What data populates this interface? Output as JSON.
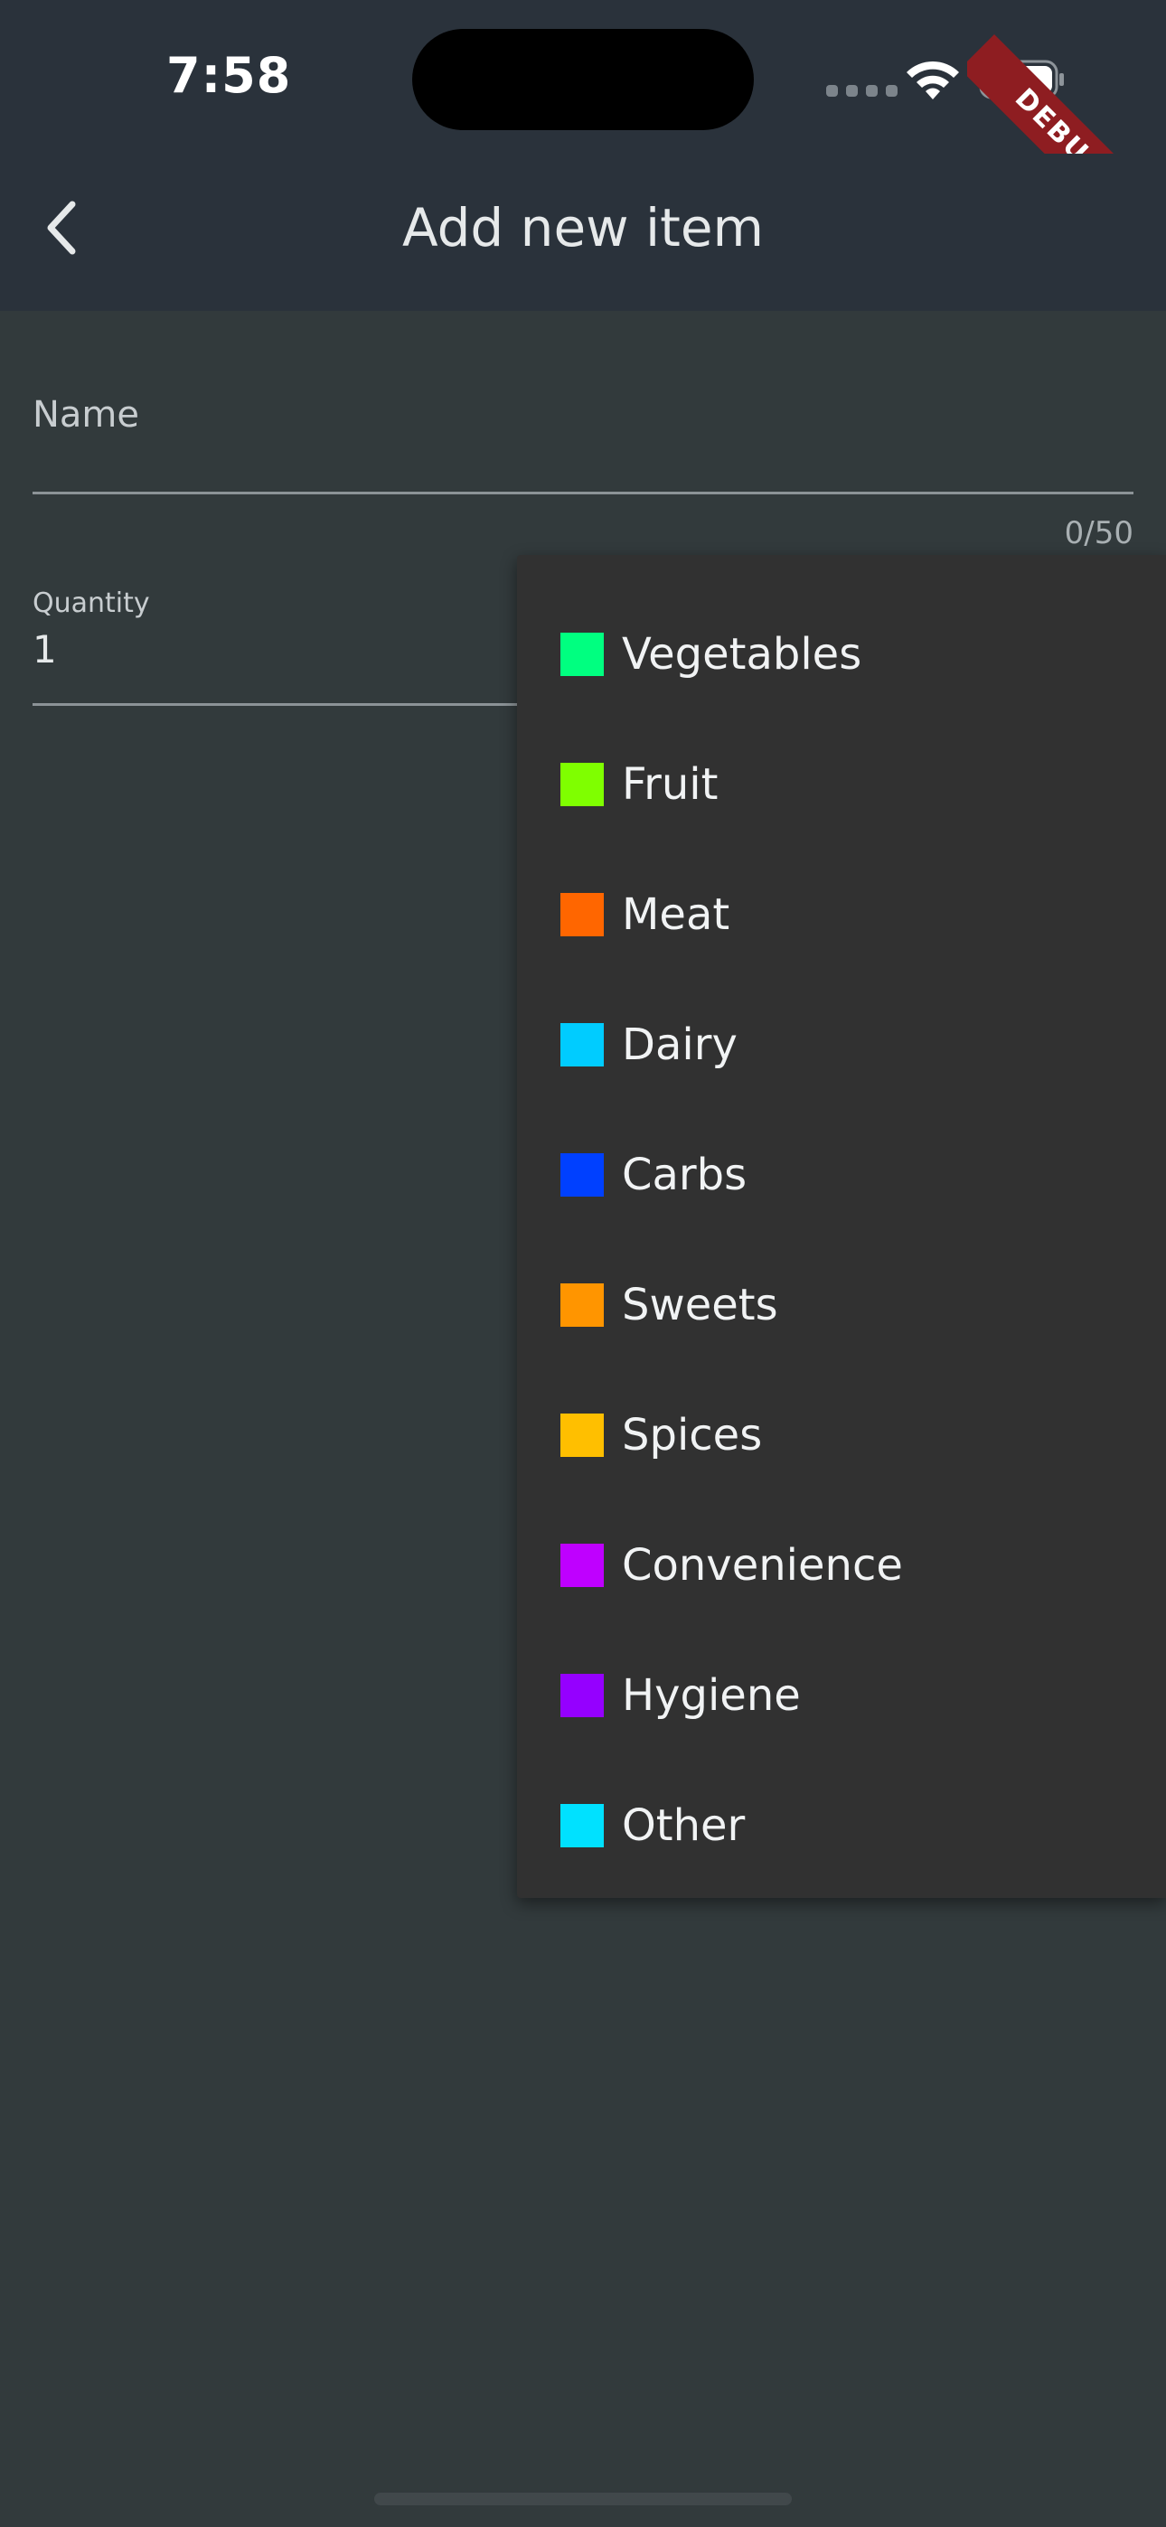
{
  "status_bar": {
    "time": "7:58",
    "debug_label": "DEBUG"
  },
  "app_bar": {
    "title": "Add new item",
    "back_icon": "chevron-left-icon"
  },
  "form": {
    "name_label": "Name",
    "name_value": "",
    "char_counter": "0/50",
    "quantity_label": "Quantity",
    "quantity_value": "1"
  },
  "category_menu": {
    "items": [
      {
        "label": "Vegetables",
        "color": "#00ff80"
      },
      {
        "label": "Fruit",
        "color": "#7fff00"
      },
      {
        "label": "Meat",
        "color": "#ff6600"
      },
      {
        "label": "Dairy",
        "color": "#00ccff"
      },
      {
        "label": "Carbs",
        "color": "#0040ff"
      },
      {
        "label": "Sweets",
        "color": "#ff9500"
      },
      {
        "label": "Spices",
        "color": "#ffbf00"
      },
      {
        "label": "Convenience",
        "color": "#bf00ff"
      },
      {
        "label": "Hygiene",
        "color": "#9500ff"
      },
      {
        "label": "Other",
        "color": "#00e1ff"
      }
    ]
  },
  "colors": {
    "background": "#323a3c",
    "app_bar": "#2a323b",
    "menu_background": "#313131",
    "debug_ribbon": "#8e1d21"
  }
}
